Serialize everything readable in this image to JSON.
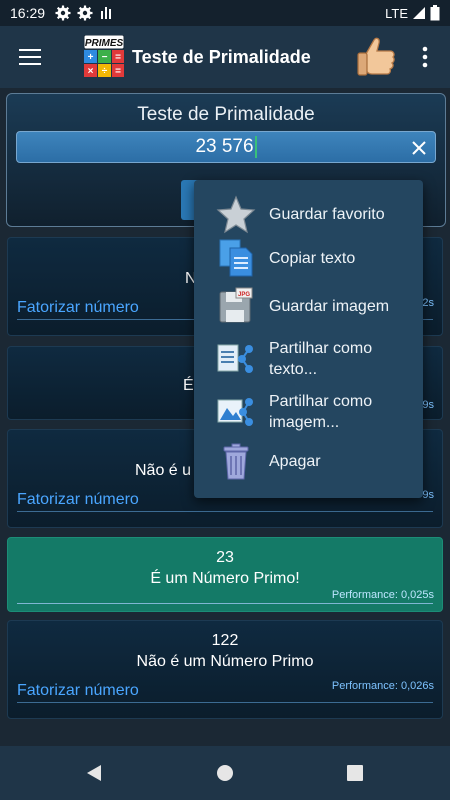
{
  "status_bar": {
    "time": "16:29",
    "network": "LTE",
    "icons": [
      "gear-icon",
      "gear-icon",
      "signal-bars-icon",
      "lte-signal-icon",
      "battery-icon"
    ]
  },
  "app_bar": {
    "title": "Teste de Primalidade",
    "logo_text": "PRIMES",
    "icons": [
      "menu-icon",
      "primes-logo",
      "thumbs-up-icon",
      "overflow-menu-icon"
    ]
  },
  "test_panel": {
    "title": "Teste de Primalidade",
    "input_value": "23 576"
  },
  "results": [
    {
      "number": "",
      "message": "Não é um",
      "factor_label": "Fatorizar número",
      "performance": "2s",
      "is_prime": false
    },
    {
      "number": "",
      "message": "É um N",
      "factor_label": "",
      "performance": "9s",
      "is_prime": false
    },
    {
      "number": "",
      "message": "Não é u",
      "factor_label": "Fatorizar número",
      "performance": "9s",
      "is_prime": false
    },
    {
      "number": "23",
      "message": "É um Número Primo!",
      "factor_label": "",
      "performance": "Performance: 0,025s",
      "is_prime": true
    },
    {
      "number": "122",
      "message": "Não é um Número Primo",
      "factor_label": "Fatorizar número",
      "performance": "Performance: 0,026s",
      "is_prime": false
    }
  ],
  "context_menu": {
    "items": [
      {
        "label_1": "Guardar favorito",
        "label_2": "",
        "icon": "star-icon"
      },
      {
        "label_1": "Copiar texto",
        "label_2": "",
        "icon": "copy-icon"
      },
      {
        "label_1": "Guardar imagem",
        "label_2": "",
        "icon": "save-image-icon"
      },
      {
        "label_1": "Partilhar como",
        "label_2": "texto...",
        "icon": "share-text-icon"
      },
      {
        "label_1": "Partilhar como",
        "label_2": "imagem...",
        "icon": "share-image-icon"
      },
      {
        "label_1": "Apagar",
        "label_2": "",
        "icon": "trash-icon"
      }
    ]
  },
  "nav_bar": {
    "icons": [
      "back-icon",
      "home-icon",
      "recents-icon"
    ]
  },
  "colors": {
    "app_bar": "#1f3548",
    "background": "#1b2834",
    "prime_card": "#147a67",
    "link": "#4aa6ff",
    "input": "#2c6ea6",
    "menu": "#244660"
  }
}
